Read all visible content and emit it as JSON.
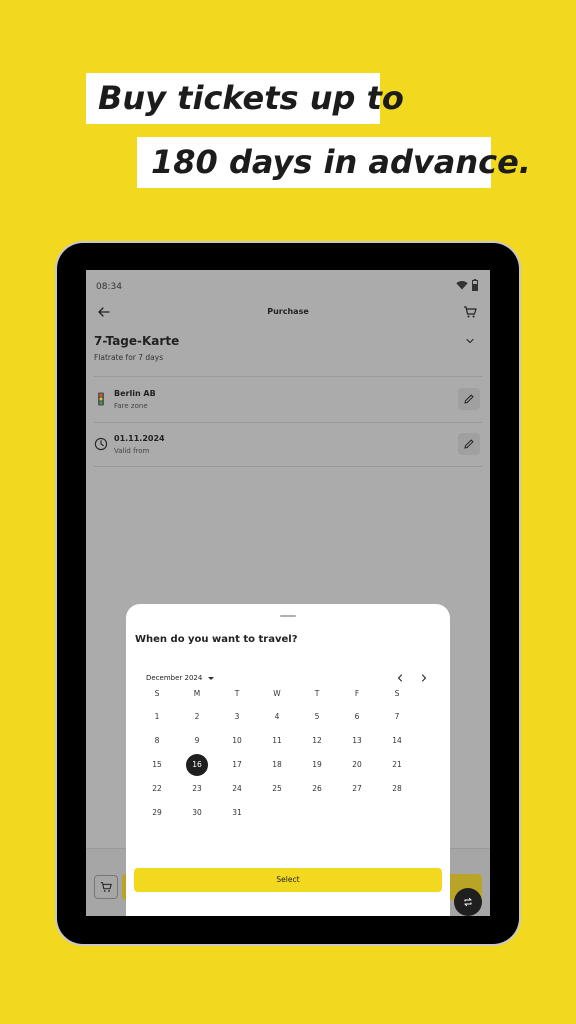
{
  "promo": {
    "line1": "Buy tickets up to",
    "line2": "180 days in advance."
  },
  "status_bar": {
    "time": "08:34"
  },
  "app_bar": {
    "title": "Purchase"
  },
  "product": {
    "title": "7-Tage-Karte",
    "subtitle": "Flatrate for 7 days"
  },
  "rows": [
    {
      "value": "Berlin AB",
      "label": "Fare zone",
      "icon": "traffic-light-icon"
    },
    {
      "value": "01.11.2024",
      "label": "Valid from",
      "icon": "clock-icon"
    }
  ],
  "date_sheet": {
    "title": "When do you want to travel?",
    "month_label": "December 2024",
    "weekdays": [
      "S",
      "M",
      "T",
      "W",
      "T",
      "F",
      "S"
    ],
    "first_weekday_index": 0,
    "days_in_month": 31,
    "selected_day": 16,
    "select_label": "Select"
  },
  "colors": {
    "background": "#f2d81f",
    "accent": "#f2d81f",
    "selected_day": "#1f1f1f"
  }
}
